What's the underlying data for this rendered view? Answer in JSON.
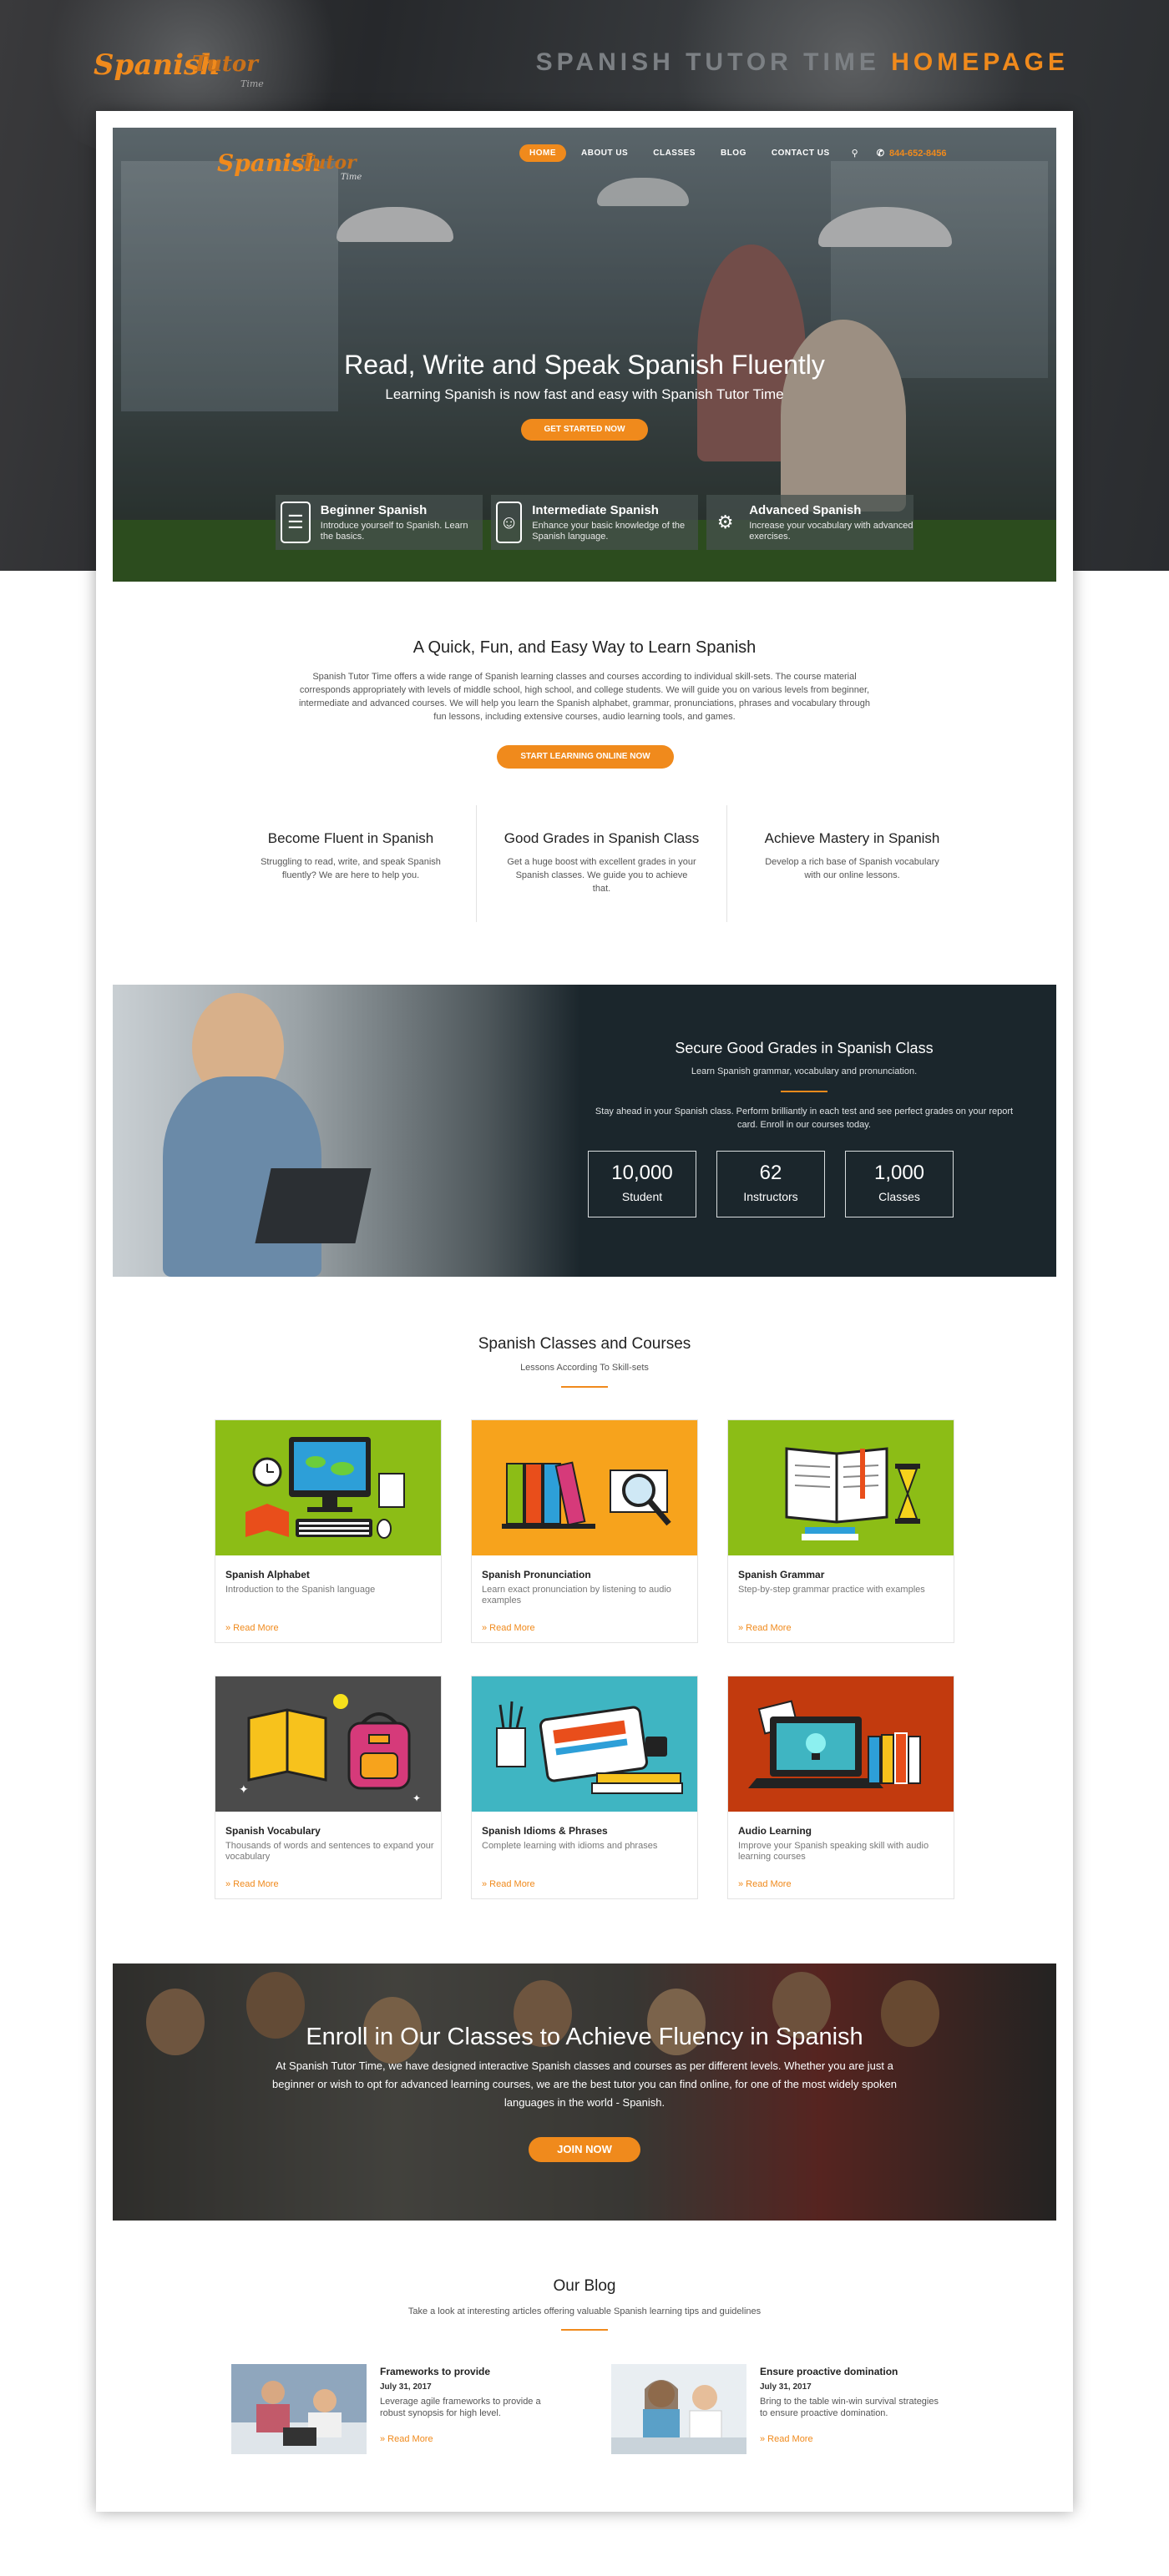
{
  "brand": {
    "word1": "Spanish",
    "word2": "Tutor",
    "word3": "Time"
  },
  "page_title": {
    "part1": "SPANISH TUTOR TIME",
    "part2": "HOMEPAGE"
  },
  "nav": {
    "items": [
      "HOME",
      "ABOUT US",
      "CLASSES",
      "BLOG",
      "CONTACT US"
    ],
    "phone": "844-652-8456"
  },
  "hero": {
    "title": "Read, Write and Speak Spanish Fluently",
    "subtitle": "Learning Spanish is now fast and easy with Spanish Tutor Time",
    "button": "GET STARTED NOW",
    "levels": [
      {
        "title": "Beginner Spanish",
        "desc": "Introduce yourself to Spanish. Learn the basics.",
        "icon": "book-icon"
      },
      {
        "title": "Intermediate Spanish",
        "desc": "Enhance your basic knowledge of the Spanish language.",
        "icon": "reading-icon"
      },
      {
        "title": "Advanced Spanish",
        "desc": "Increase your vocabulary with advanced exercises.",
        "icon": "hand-gear-icon"
      }
    ]
  },
  "intro": {
    "title": "A Quick, Fun, and Easy Way to Learn Spanish",
    "text": "Spanish Tutor Time offers a wide range of Spanish learning classes and courses according to individual skill-sets. The course material corresponds appropriately with levels of middle school, high school, and college students. We will guide you on various levels from beginner, intermediate and advanced courses. We will help you learn the Spanish alphabet, grammar, pronunciations, phrases and vocabulary through fun lessons, including extensive courses, audio learning tools, and games.",
    "button": "START LEARNING ONLINE NOW"
  },
  "features": [
    {
      "title": "Become Fluent in Spanish",
      "desc": "Struggling to read, write, and speak Spanish fluently? We are here to help you."
    },
    {
      "title": "Good Grades in Spanish Class",
      "desc": "Get a huge boost with excellent grades in your Spanish classes. We guide you to achieve that."
    },
    {
      "title": "Achieve Mastery in Spanish",
      "desc": "Develop a rich base of Spanish vocabulary with our online lessons."
    }
  ],
  "stats": {
    "title": "Secure Good Grades in Spanish Class",
    "subtitle": "Learn Spanish grammar, vocabulary and pronunciation.",
    "desc": "Stay ahead in your Spanish class. Perform brilliantly in each test and see perfect grades on your report card. Enroll in our courses today.",
    "items": [
      {
        "num": "10,000",
        "label": "Student"
      },
      {
        "num": "62",
        "label": "Instructors"
      },
      {
        "num": "1,000",
        "label": "Classes"
      }
    ]
  },
  "classes": {
    "title": "Spanish Classes and Courses",
    "subtitle": "Lessons According To Skill-sets",
    "read_more": "» Read More",
    "items": [
      {
        "title": "Spanish Alphabet",
        "desc": "Introduction to the Spanish language",
        "bg": "#8cbd16"
      },
      {
        "title": "Spanish Pronunciation",
        "desc": "Learn exact pronunciation by listening to audio examples",
        "bg": "#f7a31c"
      },
      {
        "title": "Spanish Grammar",
        "desc": "Step-by-step grammar practice with examples",
        "bg": "#8cbd16"
      },
      {
        "title": "Spanish Vocabulary",
        "desc": "Thousands of words and sentences to expand your vocabulary",
        "bg": "#4b4b4b"
      },
      {
        "title": "Spanish Idioms & Phrases",
        "desc": "Complete learning with idioms and phrases",
        "bg": "#3fb5c2"
      },
      {
        "title": "Audio Learning",
        "desc": "Improve your Spanish speaking skill with audio learning courses",
        "bg": "#c23a0e"
      }
    ]
  },
  "enroll": {
    "title": "Enroll in Our Classes to Achieve Fluency in Spanish",
    "text": "At Spanish Tutor Time, we have designed interactive Spanish classes and courses as per different levels. Whether you are just a beginner or wish to opt for advanced learning courses, we are the best tutor you can find online, for one of the most widely spoken languages in the world - Spanish.",
    "button": "JOIN NOW"
  },
  "blog": {
    "title": "Our Blog",
    "subtitle": "Take a look at interesting articles offering valuable Spanish learning tips and guidelines",
    "posts": [
      {
        "title": "Frameworks to provide",
        "date": "July 31, 2017",
        "desc": "Leverage agile frameworks to provide a robust synopsis for high level.",
        "more": "» Read More"
      },
      {
        "title": "Ensure proactive domination",
        "date": "July 31, 2017",
        "desc": "Bring to the table win-win survival strategies to ensure proactive domination.",
        "more": "» Read More"
      }
    ]
  },
  "colors": {
    "accent": "#f08a1c",
    "dark": "#1b262c"
  }
}
